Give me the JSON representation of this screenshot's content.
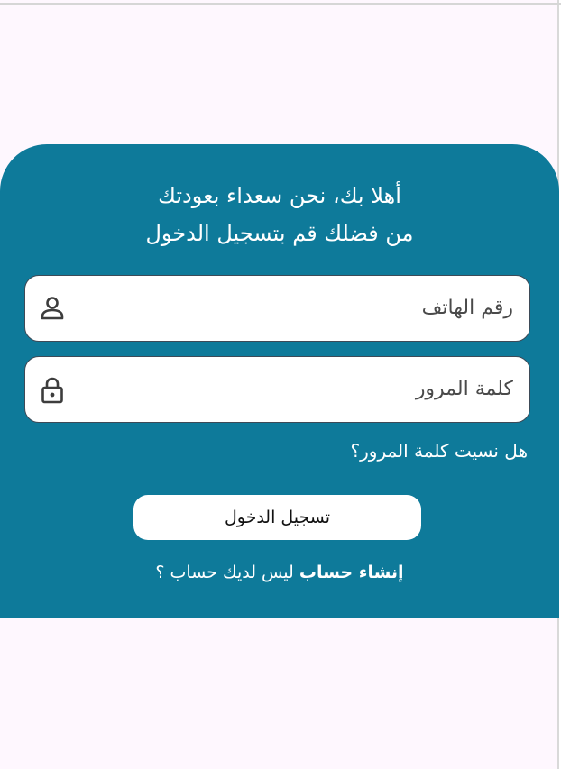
{
  "welcome": {
    "line1": "أهلا بك، نحن سعداء بعودتك",
    "line2": "من فضلك قم بتسجيل الدخول"
  },
  "phone_field": {
    "placeholder": "رقم الهاتف",
    "icon": "person-icon"
  },
  "password_field": {
    "placeholder": "كلمة المرور",
    "icon": "lock-icon"
  },
  "forgot_password": "هل نسيت كلمة المرور؟",
  "login_button": "تسجيل الدخول",
  "signup": {
    "link": "إنشاء حساب",
    "prompt": "ليس لديك حساب ؟"
  },
  "colors": {
    "card": "#0e7a9a",
    "background": "#fef7fe"
  }
}
